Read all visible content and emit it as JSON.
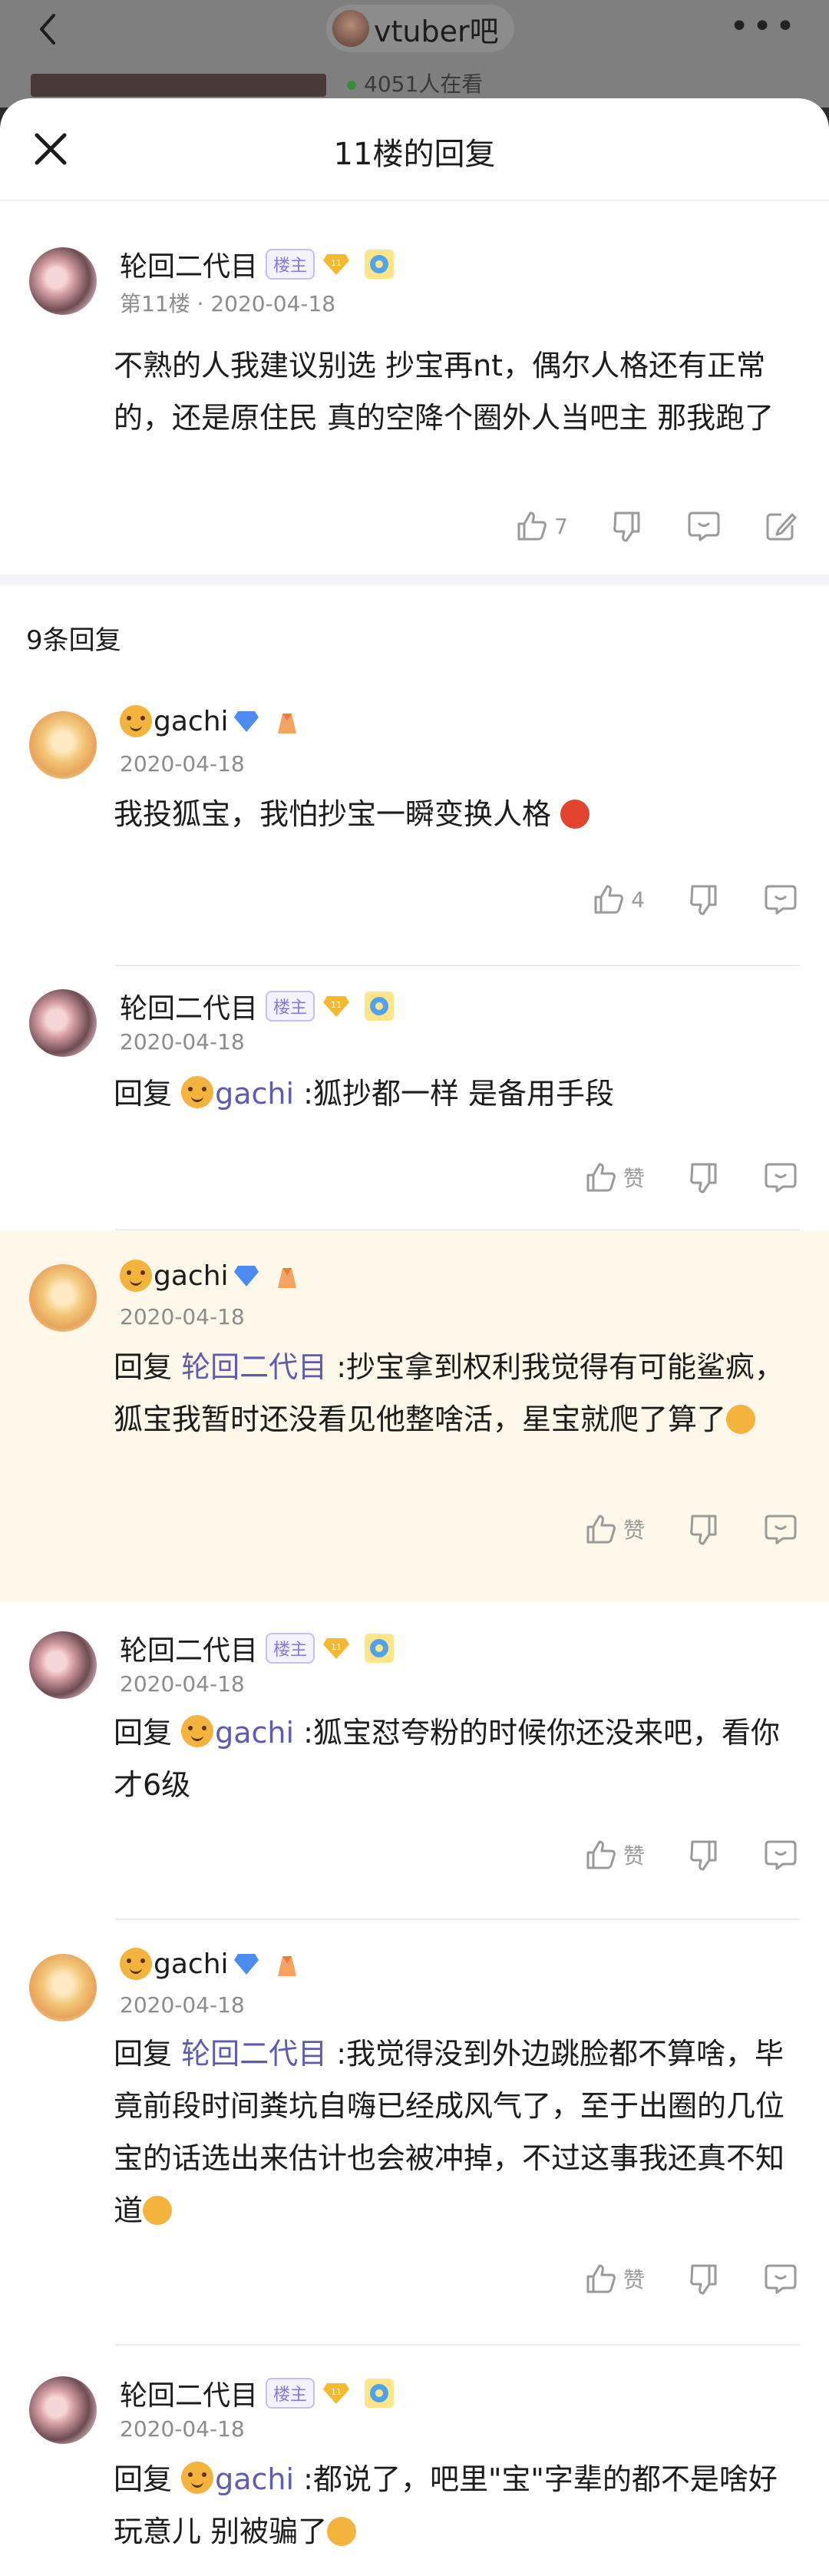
{
  "background": {
    "forum_title": "vtuber吧",
    "online_text": "4051人在看"
  },
  "sheet": {
    "title": "11楼的回复"
  },
  "main_post": {
    "username": "轮回二代目",
    "host_badge": "楼主",
    "level": "11",
    "floor": "第11楼",
    "date": "2020-04-18",
    "content": "不熟的人我建议别选 抄宝再nt，偶尔人格还有正常的，还是原住民 真的空降个圈外人当吧主 那我跑了",
    "like_count": "7"
  },
  "reply_count_label": "9条回复",
  "replies": [
    {
      "username": "gachi",
      "date": "2020-04-18",
      "content": "我投狐宝，我怕抄宝一瞬变换人格",
      "like_label": "4"
    },
    {
      "username": "轮回二代目",
      "host_badge": "楼主",
      "level": "11",
      "date": "2020-04-18",
      "reply_prefix": "回复",
      "reply_to": "gachi",
      "content": " :狐抄都一样 是备用手段",
      "like_label": "赞"
    },
    {
      "username": "gachi",
      "date": "2020-04-18",
      "reply_prefix": "回复",
      "reply_to": "轮回二代目",
      "content": " :抄宝拿到权利我觉得有可能鲨疯，狐宝我暂时还没看见他整啥活，星宝就爬了算了",
      "like_label": "赞"
    },
    {
      "username": "轮回二代目",
      "host_badge": "楼主",
      "level": "11",
      "date": "2020-04-18",
      "reply_prefix": "回复",
      "reply_to": "gachi",
      "content": " :狐宝怼夸粉的时候你还没来吧，看你才6级",
      "like_label": "赞"
    },
    {
      "username": "gachi",
      "date": "2020-04-18",
      "reply_prefix": "回复",
      "reply_to": "轮回二代目",
      "content": " :我觉得没到外边跳脸都不算啥，毕竟前段时间粪坑自嗨已经成风气了，至于出圈的几位宝的话选出来估计也会被冲掉，不过这事我还真不知道",
      "like_label": "赞"
    },
    {
      "username": "轮回二代目",
      "host_badge": "楼主",
      "level": "11",
      "date": "2020-04-18",
      "reply_prefix": "回复",
      "reply_to": "gachi",
      "content": " :都说了，吧里\"宝\"字辈的都不是啥好玩意儿 别被骗了"
    }
  ],
  "colors": {
    "link": "#5f5bb0",
    "highlight_bg": "#fdf8e9",
    "host_badge": "#8a78d8"
  }
}
